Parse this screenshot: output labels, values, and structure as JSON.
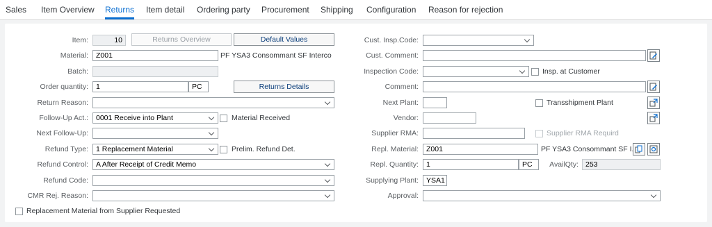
{
  "tabs": [
    {
      "label": "Sales",
      "active": false
    },
    {
      "label": "Item Overview",
      "active": false
    },
    {
      "label": "Returns",
      "active": true
    },
    {
      "label": "Item detail",
      "active": false
    },
    {
      "label": "Ordering party",
      "active": false
    },
    {
      "label": "Procurement",
      "active": false
    },
    {
      "label": "Shipping",
      "active": false
    },
    {
      "label": "Configuration",
      "active": false
    },
    {
      "label": "Reason for rejection",
      "active": false
    }
  ],
  "left": {
    "item": {
      "label": "Item:",
      "value": "10"
    },
    "returns_overview_button": "Returns Overview",
    "default_values_button": "Default Values",
    "material": {
      "label": "Material:",
      "value": "Z001",
      "description": "PF YSA3 Consommant SF Interco"
    },
    "batch": {
      "label": "Batch:",
      "value": ""
    },
    "order_quantity": {
      "label": "Order quantity:",
      "value": "1",
      "unit": "PC"
    },
    "returns_details_button": "Returns Details",
    "return_reason": {
      "label": "Return Reason:",
      "value": ""
    },
    "follow_up_act": {
      "label": "Follow-Up Act.:",
      "value": "0001 Receive into Plant"
    },
    "material_received": {
      "label": "Material Received",
      "checked": false
    },
    "next_follow_up": {
      "label": "Next Follow-Up:",
      "value": ""
    },
    "refund_type": {
      "label": "Refund Type:",
      "value": "1 Replacement Material"
    },
    "prelim_refund_det": {
      "label": "Prelim. Refund Det.",
      "checked": false
    },
    "refund_control": {
      "label": "Refund Control:",
      "value": "A After Receipt of Credit Memo"
    },
    "refund_code": {
      "label": "Refund Code:",
      "value": ""
    },
    "cmr_rej_reason": {
      "label": "CMR Rej. Reason:",
      "value": ""
    },
    "replacement_from_supplier": {
      "label": "Replacement Material from Supplier Requested",
      "checked": false
    }
  },
  "right": {
    "cust_insp_code": {
      "label": "Cust. Insp.Code:",
      "value": ""
    },
    "cust_comment": {
      "label": "Cust. Comment:",
      "value": ""
    },
    "inspection_code": {
      "label": "Inspection Code:",
      "value": ""
    },
    "insp_at_customer": {
      "label": "Insp. at Customer",
      "checked": false
    },
    "comment": {
      "label": "Comment:",
      "value": ""
    },
    "next_plant": {
      "label": "Next Plant:",
      "value": ""
    },
    "transshipment_plant": {
      "label": "Transshipment Plant",
      "checked": false
    },
    "vendor": {
      "label": "Vendor:",
      "value": ""
    },
    "supplier_rma": {
      "label": "Supplier RMA:",
      "value": ""
    },
    "supplier_rma_required": {
      "label": "Supplier RMA Requird",
      "checked": false
    },
    "repl_material": {
      "label": "Repl. Material:",
      "value": "Z001",
      "description": "PF YSA3 Consommant SF I..."
    },
    "repl_quantity": {
      "label": "Repl. Quantity:",
      "value": "1",
      "unit": "PC"
    },
    "avail_qty": {
      "label": "AvailQty:",
      "value": "253"
    },
    "supplying_plant": {
      "label": "Supplying Plant:",
      "value": "YSA1"
    },
    "approval": {
      "label": "Approval:",
      "value": ""
    }
  },
  "colors": {
    "accent": "#0a6ed1",
    "background": "#f2f3f4"
  }
}
